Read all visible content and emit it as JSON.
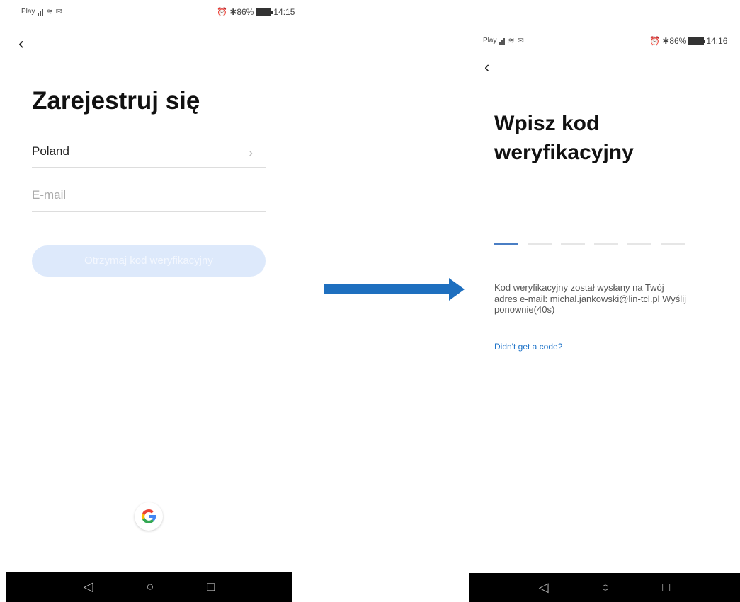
{
  "left": {
    "status": {
      "carrier": "Play",
      "indicators": "⏰ ✱86%",
      "time": "14:15"
    },
    "title": "Zarejestruj się",
    "country": {
      "value": "Poland"
    },
    "email": {
      "placeholder": "E-mail"
    },
    "button_label": "Otrzymaj kod weryfikacyjny",
    "google_icon": "G"
  },
  "right": {
    "status": {
      "carrier": "Play",
      "indicators": "⏰ ✱86%",
      "time": "14:16"
    },
    "title_line1": "Wpisz kod",
    "title_line2": "weryfikacyjny",
    "code_slots": 6,
    "info_line1": "Kod weryfikacyjny został wysłany na Twój",
    "info_line2": "adres e-mail: michal.jankowski@lin-tcl.pl  Wyślij",
    "info_line3": "ponownie(40s)",
    "link": "Didn't get a code?"
  },
  "colors": {
    "arrow": "#1e6fbf",
    "button_bg": "#dde9fb",
    "link": "#1e73c8"
  },
  "icons": {
    "back": "back-chevron-icon",
    "nav": [
      "nav-back-icon",
      "nav-home-icon",
      "nav-recents-icon"
    ]
  }
}
